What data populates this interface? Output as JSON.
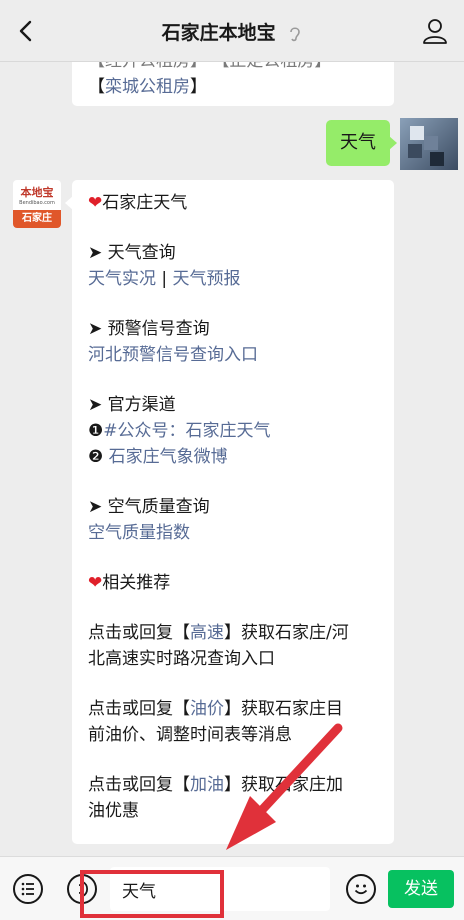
{
  "header": {
    "title": "石家庄本地宝"
  },
  "chat": {
    "prev_message": {
      "line1": "【经开公租房】 【正定公租房】",
      "line2_link": "栾城公租房"
    },
    "user_message": "天气",
    "reply": {
      "title": "石家庄天气",
      "query": {
        "heading": "天气查询",
        "link1": "天气实况",
        "sep": " | ",
        "link2": "天气预报"
      },
      "warning": {
        "heading": "预警信号查询",
        "link": "河北预警信号查询入口"
      },
      "official": {
        "heading": "官方渠道",
        "item1_num": "❶",
        "item1_link": "#公众号：石家庄天气",
        "item2_num": "❷",
        "item2_link": "石家庄气象微博"
      },
      "air": {
        "heading": "空气质量查询",
        "link": "空气质量指数"
      },
      "related": "相关推荐",
      "recommendations": [
        {
          "pre": "点击或回复【",
          "kw": "高速",
          "post_line1": "】获取石家庄/河",
          "line2": "北高速实时路况查询入口"
        },
        {
          "pre": "点击或回复【",
          "kw": "油价",
          "post_line1": "】获取石家庄目",
          "line2": "前油价、调整时间表等消息"
        },
        {
          "pre": "点击或回复【",
          "kw": "加油",
          "post_line1": "】获取石家庄加",
          "line2": "油优惠"
        }
      ]
    }
  },
  "avatar": {
    "bot_top": "本地宝",
    "bot_mid": "Bendibao.com",
    "bot_bottom": "石家庄"
  },
  "input": {
    "value": "天气"
  },
  "send_label": "发送",
  "colors": {
    "link": "#576b95",
    "send": "#07c160",
    "my_bubble": "#95ec69",
    "highlight": "#e0313a"
  }
}
